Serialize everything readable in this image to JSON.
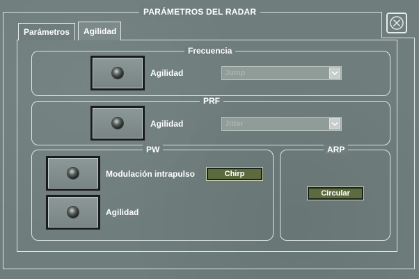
{
  "window": {
    "title": "PARÁMETROS DEL RADAR"
  },
  "tabs": [
    {
      "label": "Parámetros",
      "active": false
    },
    {
      "label": "Agilidad",
      "active": true
    }
  ],
  "frecuencia": {
    "title": "Frecuencia",
    "label": "Agilidad",
    "select_value": "Jump"
  },
  "prf": {
    "title": "PRF",
    "label": "Agilidad",
    "select_value": "Jitter"
  },
  "pw": {
    "title": "PW",
    "mod_label": "Modulación intrapulso",
    "mod_value": "Chirp",
    "agility_label": "Agilidad"
  },
  "arp": {
    "title": "ARP",
    "value": "Circular"
  },
  "colors": {
    "background": "#6f7d7d",
    "accent_button": "#5c6b3f",
    "line": "#dfe6e6"
  },
  "icons": {
    "close": "close-circle-x-icon",
    "led": "led-indicator-icon",
    "dropdown": "chevron-down-icon"
  }
}
